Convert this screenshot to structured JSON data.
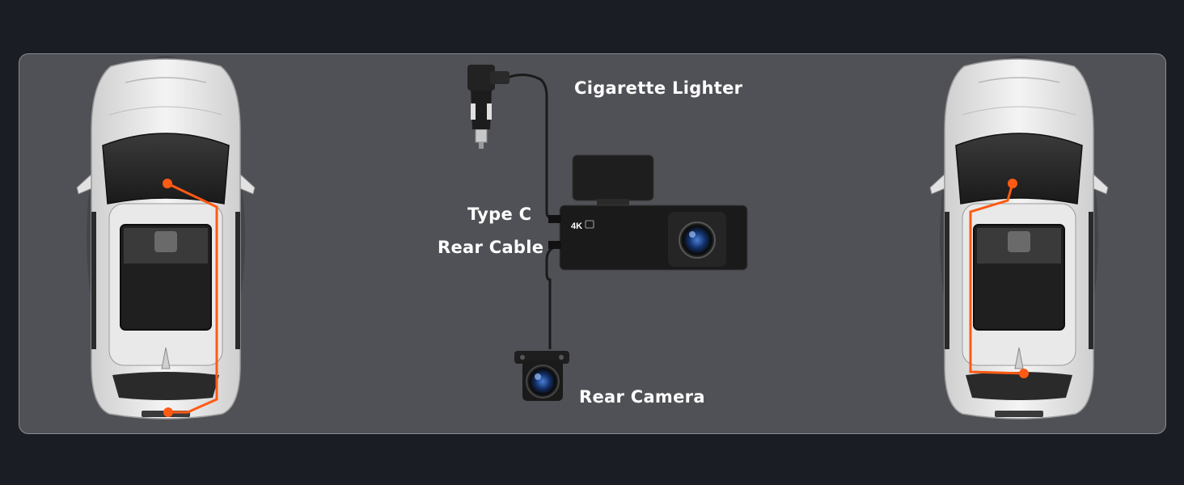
{
  "labels": {
    "cigarette_lighter": "Cigarette Lighter",
    "type_c": "Type C",
    "rear_cable": "Rear Cable",
    "rear_camera": "Rear Camera"
  },
  "dashcam_badge": {
    "resolution": "4K"
  },
  "colors": {
    "background": "#1b1d24",
    "panel": "#505156",
    "route": "#ff5a14",
    "car_body": "#e6e6e6"
  },
  "icons": [
    "car-top-view-icon",
    "car-charger-icon",
    "dash-camera-icon",
    "rear-camera-icon"
  ]
}
